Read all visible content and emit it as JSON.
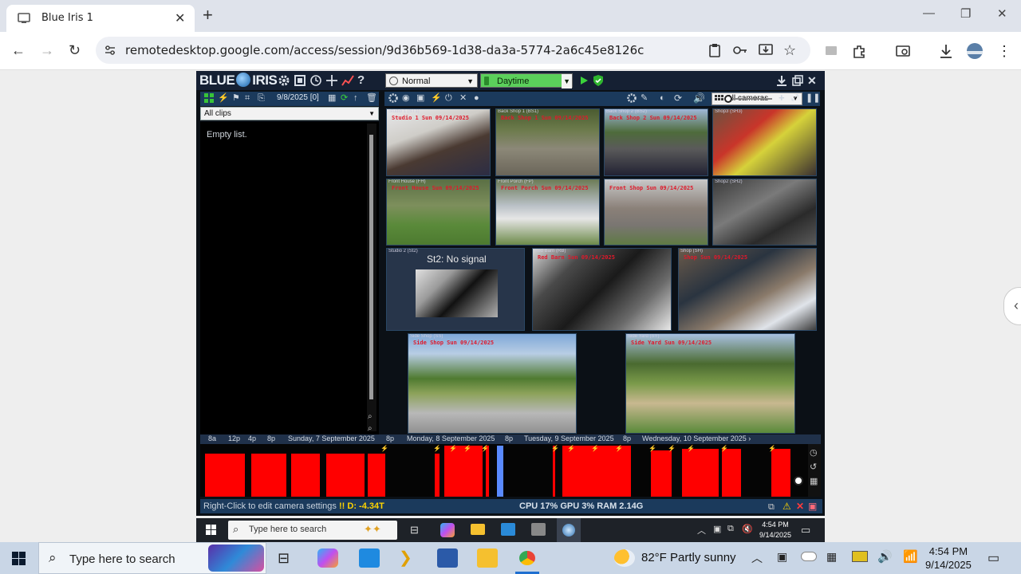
{
  "browser": {
    "tab_title": "Blue Iris 1",
    "tab_close": "✕",
    "new_tab": "+",
    "url": "remotedesktop.google.com/access/session/9d36b569-1d38-da3a-5774-2a6c45e8126c"
  },
  "blueiris": {
    "logo_left": "BLUE",
    "logo_right": "IRIS",
    "profile_select": "Normal",
    "schedule_select": "Daytime",
    "left_panel": {
      "date_label": "9/8/2025 [0]",
      "clips_filter": "All clips",
      "empty_text": "Empty list."
    },
    "camera_group": "All cameras",
    "cameras": [
      {
        "label": "Studio 1 (ST1)",
        "stamp": "Studio 1 Sun 09/14/2025"
      },
      {
        "label": "Back Shop 1 (BS1)",
        "stamp": "Back Shop 1 Sun 09/14/2025"
      },
      {
        "label": "Back Shop 2 (BS2)",
        "stamp": "Back Shop 2 Sun 09/14/2025"
      },
      {
        "label": "Shop3 (SH3)",
        "stamp": ""
      },
      {
        "label": "Front House (FH)",
        "stamp": "Front House Sun 09/14/2025"
      },
      {
        "label": "Front Porch (FP)",
        "stamp": "Front Porch Sun 09/14/2025"
      },
      {
        "label": "Front Shop (FS)",
        "stamp": "Front Shop Sun 09/14/2025"
      },
      {
        "label": "Shop2 (SH2)",
        "stamp": ""
      },
      {
        "label": "Studio 2 (St2)",
        "stamp": ""
      },
      {
        "label": "Red Barn (RB)",
        "stamp": "Red Barn Sun 09/14/2025"
      },
      {
        "label": "Shop (SH)",
        "stamp": "Shop Sun 09/14/2025"
      },
      {
        "label": "Side Shop (SS)",
        "stamp": "Side Shop Sun 09/14/2025"
      },
      {
        "label": "Side Yard (SY)",
        "stamp": "Side Yard Sun 09/14/2025"
      }
    ],
    "no_signal": "St2: No signal",
    "timeline_labels": [
      "8a",
      "12p",
      "4p",
      "8p",
      "Sunday, 7 September 2025",
      "8p",
      "Monday, 8 September 2025",
      "8p",
      "Tuesday, 9 September 2025",
      "8p",
      "Wednesday, 10 September 2025 ›"
    ],
    "status_hint": "Right-Click to edit camera settings",
    "status_disk": "!! D: -4.34T",
    "status_perf": "CPU 17% GPU 3% RAM 2.14G"
  },
  "remote_taskbar": {
    "search_placeholder": "Type here to search",
    "time": "4:54 PM",
    "date": "9/14/2025"
  },
  "host_taskbar": {
    "search_placeholder": "Type here to search",
    "weather": "82°F  Partly sunny",
    "time": "4:54 PM",
    "date": "9/14/2025"
  }
}
